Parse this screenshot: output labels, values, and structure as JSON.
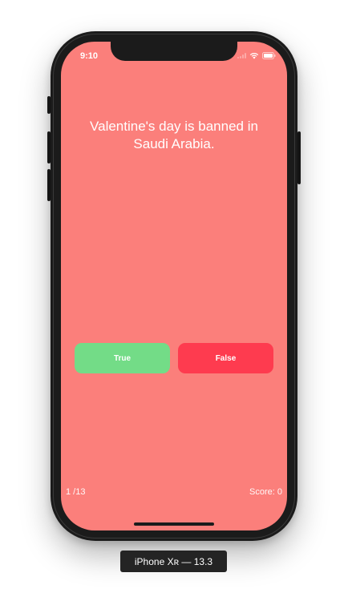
{
  "status_bar": {
    "time": "9:10"
  },
  "quiz": {
    "question": "Valentine's day is banned in Saudi Arabia.",
    "true_label": "True",
    "false_label": "False",
    "progress": "1 /13",
    "score": "Score: 0"
  },
  "simulator": {
    "device_label": "iPhone Xʀ — 13.3"
  },
  "colors": {
    "background": "#fb7f7b",
    "true_button": "#73dc87",
    "false_button": "#fe3b4f"
  },
  "icons": [
    "signal-icon",
    "wifi-icon",
    "battery-icon"
  ]
}
